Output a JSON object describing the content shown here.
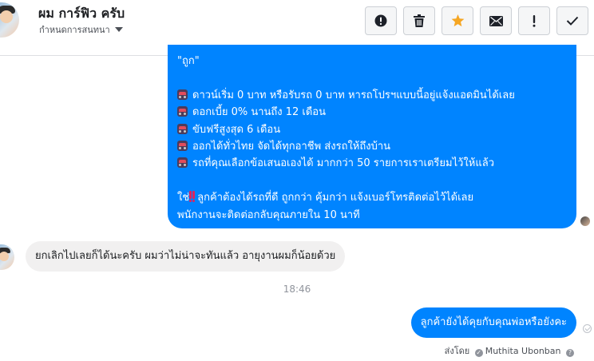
{
  "header": {
    "contact_name": "ผม การ์ฟิว ครับ",
    "subtitle": "กำหนดการสนทนา",
    "toolbar": [
      {
        "name": "report-button",
        "icon": "exclamation-circle-icon"
      },
      {
        "name": "delete-button",
        "icon": "trash-icon"
      },
      {
        "name": "star-button",
        "icon": "star-icon",
        "color": "#f5a623"
      },
      {
        "name": "mark-unread-button",
        "icon": "envelope-icon"
      },
      {
        "name": "flag-button",
        "icon": "exclamation-icon"
      },
      {
        "name": "done-button",
        "icon": "checkmark-icon"
      }
    ]
  },
  "messages": {
    "blue_bubble": {
      "first_line": "\"ถูก\"",
      "bullets": [
        "ดาวน์เริ่ม 0 บาท หรือรับรถ 0 บาท หารถโปรฯแบบนี้อยู่แจ้งแอดมินได้เลย",
        "ดอกเบี้ย 0% นานถึง 12 เดือน",
        "ขับฟรีสูงสุด 6 เดือน",
        "ออกได้ทั่วไทย จัดได้ทุกอาชีพ ส่งรถให้ถึงบ้าน",
        "รถที่คุณเลือกข้อเสนอเองได้ มากกว่า 50 รายการเราเตรียมไว้ให้แล้ว"
      ],
      "closing_prefix": "ใช่",
      "closing_line_1": "ลูกค้าต้องได้รถที่ดี ถูกกว่า คุ้มกว่า แจ้งเบอร์โทรติดต่อไว้ได้เลย",
      "closing_line_2": "พนักงานจะติดต่อกลับคุณภายใน 10 นาที"
    },
    "incoming": "ยกเลิกไปเลยก็ได้นะครับ ผมว่าไม่น่าจะทันแล้ว อายุงานผมก็น้อยด้วย",
    "timestamp": "18:46",
    "outgoing": "ลูกค้ายังได้คุยกับคุณพ่อหรือยังคะ",
    "sent_by_label": "ส่งโดย",
    "sent_by_name": "Muthita Ubonban"
  },
  "colors": {
    "accent_blue": "#0084ff",
    "incoming_bubble": "#f1f0f0",
    "star": "#f5a623"
  }
}
